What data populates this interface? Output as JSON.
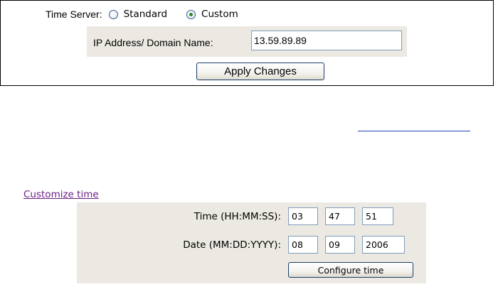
{
  "time_server": {
    "label": "Time Server:",
    "options": [
      {
        "label": "Standard",
        "selected": false
      },
      {
        "label": "Custom",
        "selected": true
      }
    ],
    "ip_label": "IP Address/ Domain Name:",
    "ip_value": "13.59.89.89",
    "apply_label": "Apply Changes"
  },
  "link_blank": "",
  "customize": {
    "link_label": "Customize time ",
    "time_label": "Time (HH:MM:SS):",
    "time_values": {
      "hh": "03",
      "mm": "47",
      "ss": "51"
    },
    "date_label": "Date (MM:DD:YYYY):",
    "date_values": {
      "mm": "08",
      "dd": "09",
      "yyyy": "2006"
    },
    "configure_label": "Configure time"
  },
  "colors": {
    "panel_bg": "#ece9e2",
    "link_visited": "#6b1f86",
    "input_border": "#7f9db9",
    "button_border": "#1c3b69"
  }
}
